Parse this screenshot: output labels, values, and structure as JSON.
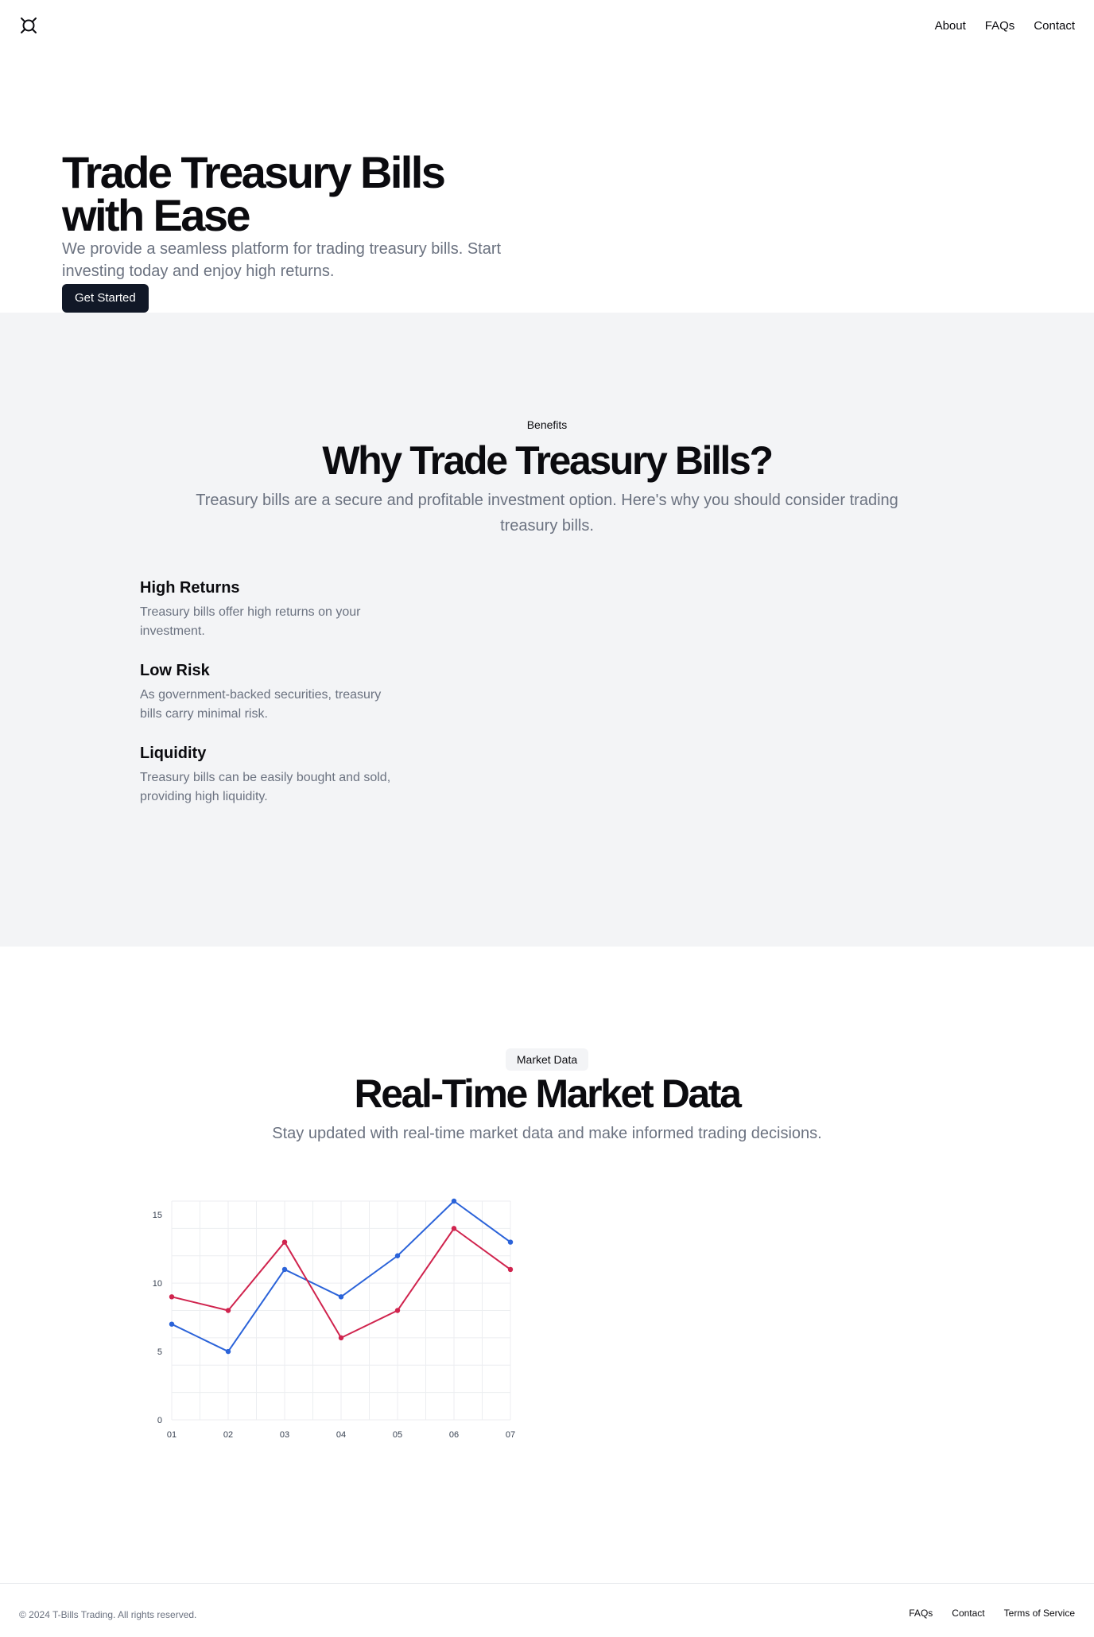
{
  "header": {
    "logo_icon": "currency-icon",
    "nav": [
      {
        "label": "About"
      },
      {
        "label": "FAQs"
      },
      {
        "label": "Contact"
      }
    ]
  },
  "hero": {
    "title": "Trade Treasury Bills with Ease",
    "subtitle": "We provide a seamless platform for trading treasury bills. Start investing today and enjoy high returns.",
    "cta_label": "Get Started"
  },
  "benefits": {
    "eyebrow": "Benefits",
    "title": "Why Trade Treasury Bills?",
    "subtitle": "Treasury bills are a secure and profitable investment option. Here's why you should consider trading treasury bills.",
    "items": [
      {
        "title": "High Returns",
        "text": "Treasury bills offer high returns on your investment."
      },
      {
        "title": "Low Risk",
        "text": "As government-backed securities, treasury bills carry minimal risk."
      },
      {
        "title": "Liquidity",
        "text": "Treasury bills can be easily bought and sold, providing high liquidity."
      }
    ]
  },
  "market": {
    "badge": "Market Data",
    "title": "Real-Time Market Data",
    "subtitle": "Stay updated with real-time market data and make informed trading decisions."
  },
  "chart_data": {
    "type": "line",
    "categories": [
      "01",
      "02",
      "03",
      "04",
      "05",
      "06",
      "07"
    ],
    "series": [
      {
        "values": [
          7,
          5,
          11,
          9,
          12,
          16,
          13
        ],
        "color": "#2b63d9"
      },
      {
        "values": [
          9,
          8,
          13,
          6,
          8,
          14,
          11
        ],
        "color": "#d0244e"
      }
    ],
    "y_ticks": [
      0,
      5,
      10,
      15
    ],
    "ylim": [
      0,
      16
    ],
    "grid": true,
    "xlabel": "",
    "ylabel": "",
    "title": ""
  },
  "footer": {
    "copyright": "© 2024 T-Bills Trading. All rights reserved.",
    "links": [
      {
        "label": "FAQs"
      },
      {
        "label": "Contact"
      },
      {
        "label": "Terms of Service"
      }
    ]
  },
  "colors": {
    "primary_button": "#111827",
    "muted_text": "#6b7280",
    "section_bg": "#f3f4f6"
  }
}
